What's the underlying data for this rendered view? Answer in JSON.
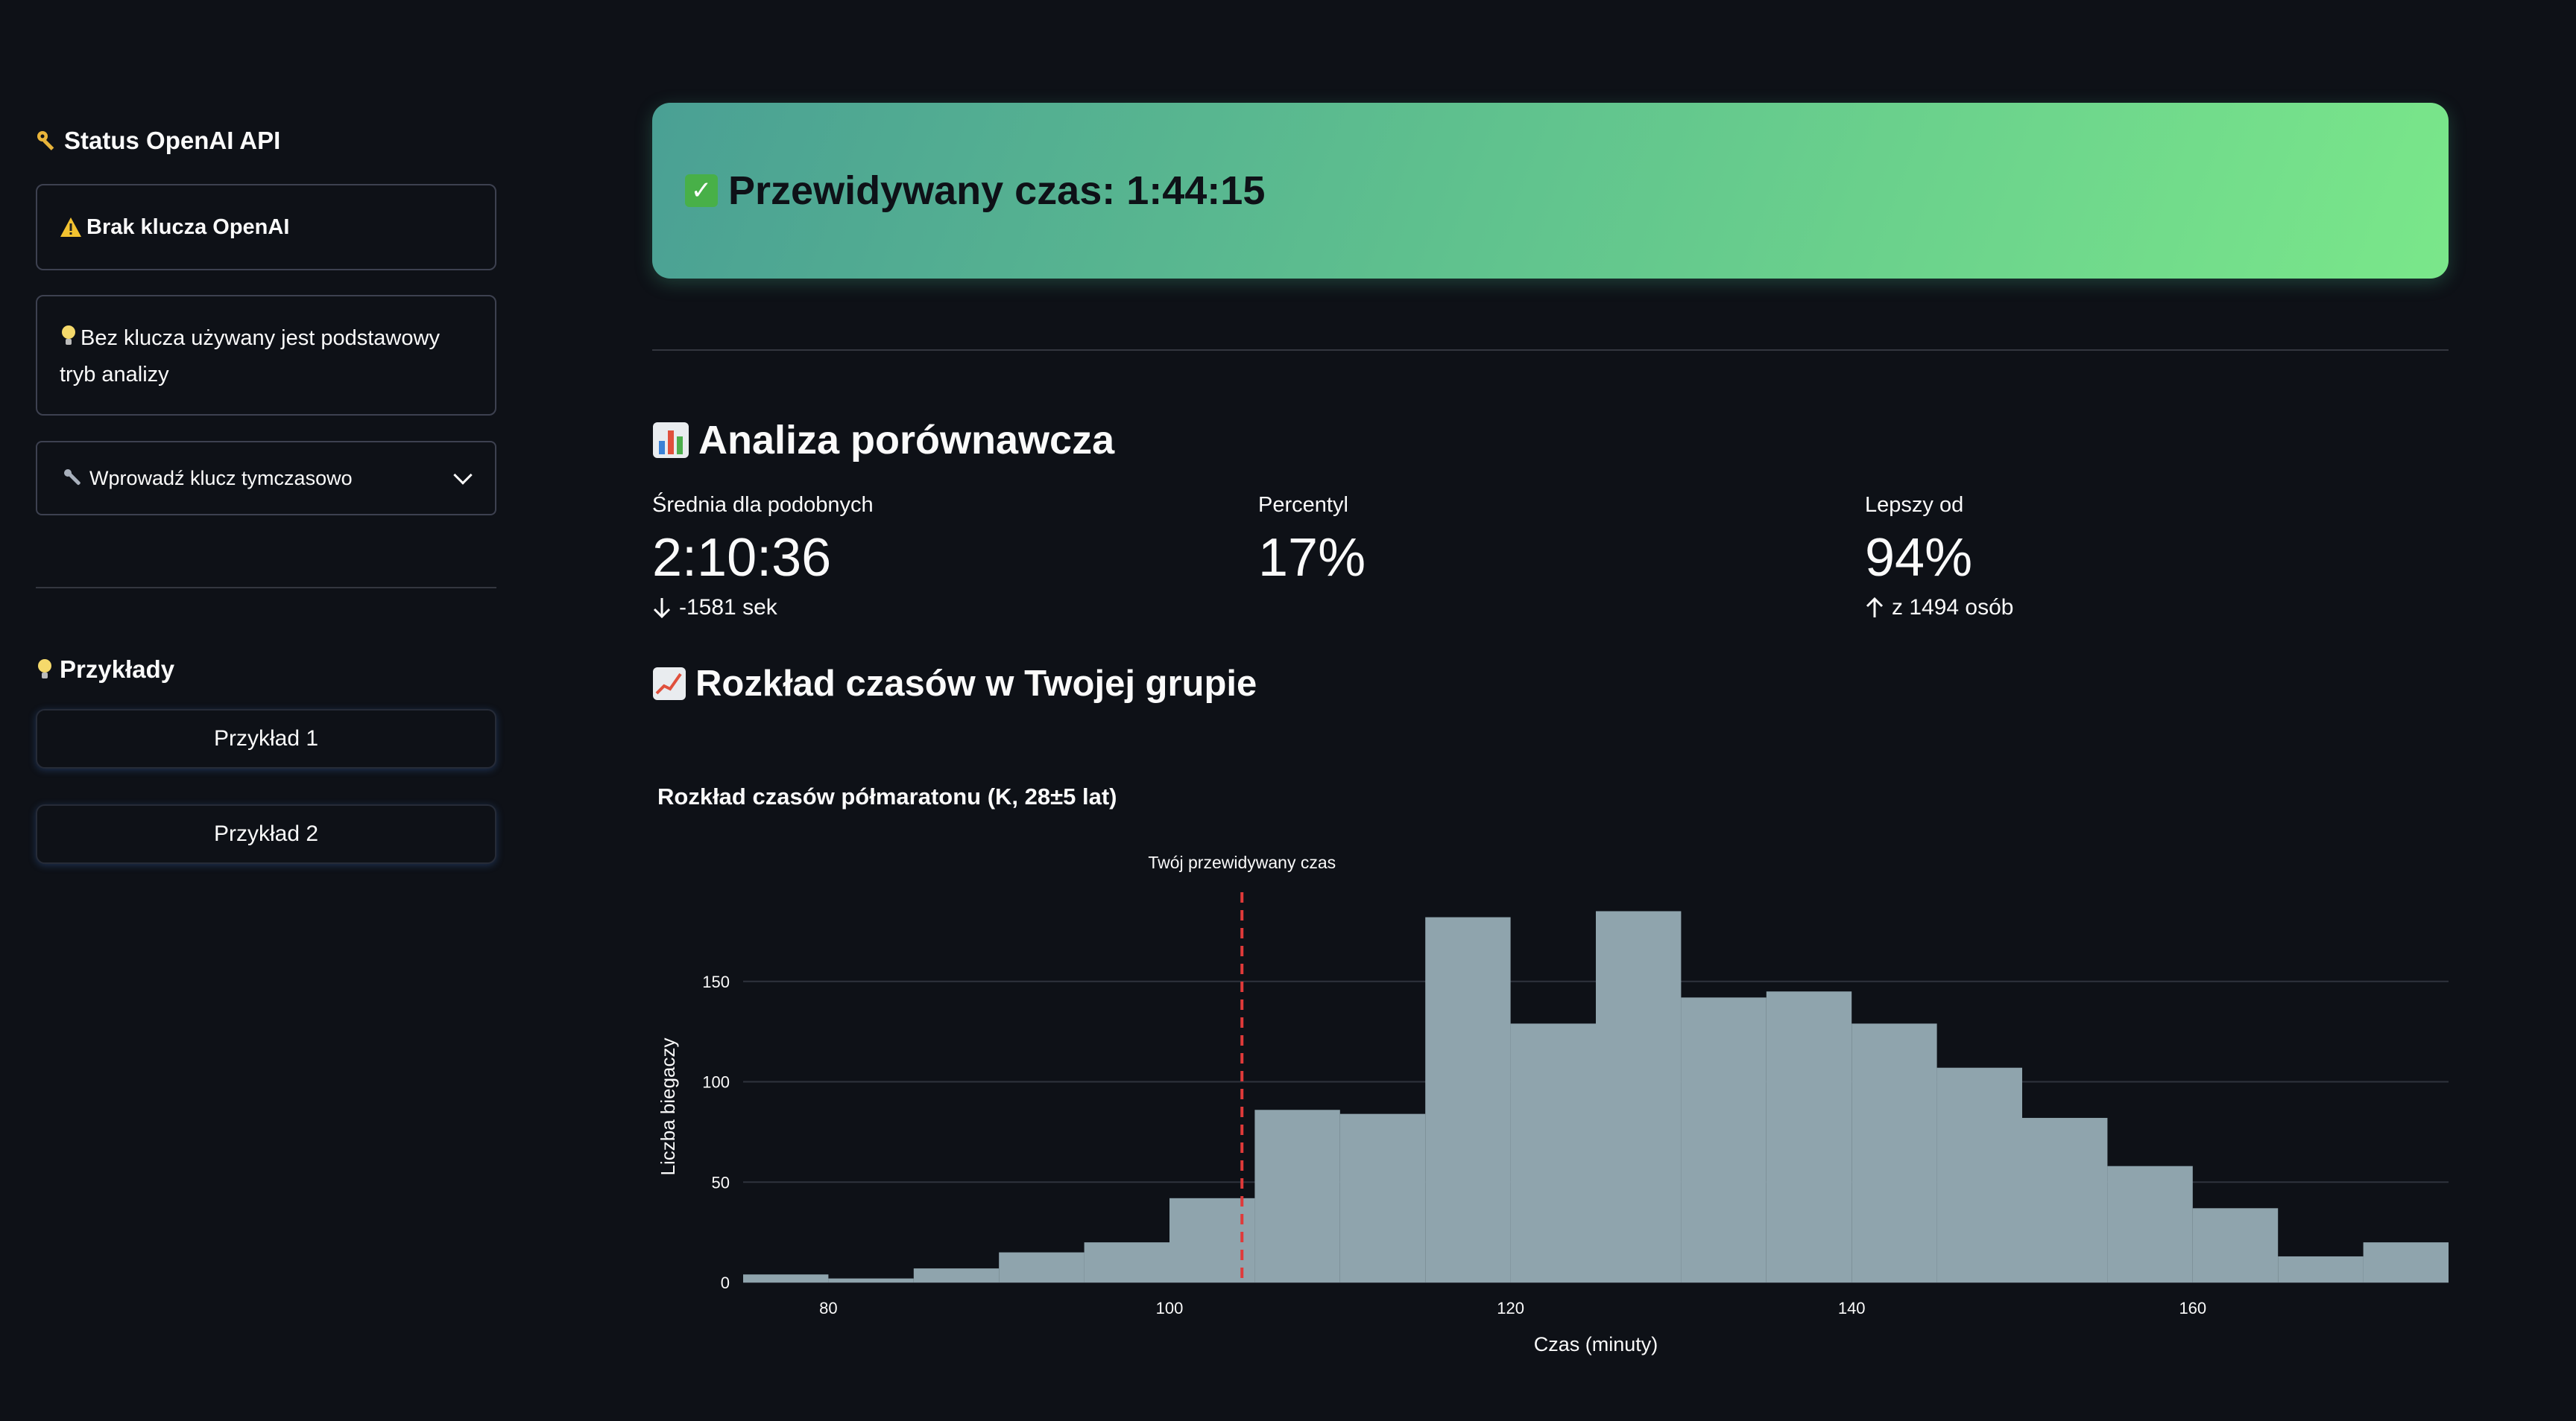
{
  "sidebar": {
    "api_heading": "Status OpenAI API",
    "warning_text": "Brak klucza OpenAI",
    "info_text": "Bez klucza używany jest podstawowy tryb analizy",
    "expander_label": "Wprowadź klucz tymczasowo",
    "examples_heading": "Przykłady",
    "example_buttons": [
      "Przykład 1",
      "Przykład 2"
    ]
  },
  "banner": {
    "text": "Przewidywany czas: 1:44:15"
  },
  "comparison": {
    "heading": "Analiza porównawcza",
    "metrics": [
      {
        "label": "Średnia dla podobnych",
        "value": "2:10:36",
        "delta": "-1581 sek",
        "delta_direction": "down"
      },
      {
        "label": "Percentyl",
        "value": "17%",
        "delta": "",
        "delta_direction": ""
      },
      {
        "label": "Lepszy od",
        "value": "94%",
        "delta": "z 1494 osób",
        "delta_direction": "up"
      }
    ]
  },
  "distribution": {
    "heading": "Rozkład czasów w Twojej grupie"
  },
  "chart_data": {
    "type": "bar",
    "title": "Rozkład czasów półmaratonu (K, 28±5 lat)",
    "xlabel": "Czas (minuty)",
    "ylabel": "Liczba biegaczy",
    "xlim": [
      75,
      175
    ],
    "ylim": [
      0,
      190
    ],
    "xticks": [
      80,
      100,
      120,
      140,
      160
    ],
    "yticks": [
      0,
      50,
      100,
      150
    ],
    "bin_edges": [
      75,
      80,
      85,
      90,
      95,
      100,
      105,
      110,
      115,
      120,
      125,
      130,
      135,
      140,
      145,
      150,
      155,
      160,
      165,
      170,
      175
    ],
    "values": [
      4,
      2,
      7,
      15,
      20,
      42,
      86,
      84,
      182,
      129,
      185,
      142,
      145,
      129,
      107,
      82,
      58,
      37,
      13,
      20
    ],
    "marker": {
      "x": 104.25,
      "label": "Twój przewidywany czas",
      "color": "#e03a3a"
    },
    "bar_color": "#8fa4ad",
    "grid": true
  }
}
